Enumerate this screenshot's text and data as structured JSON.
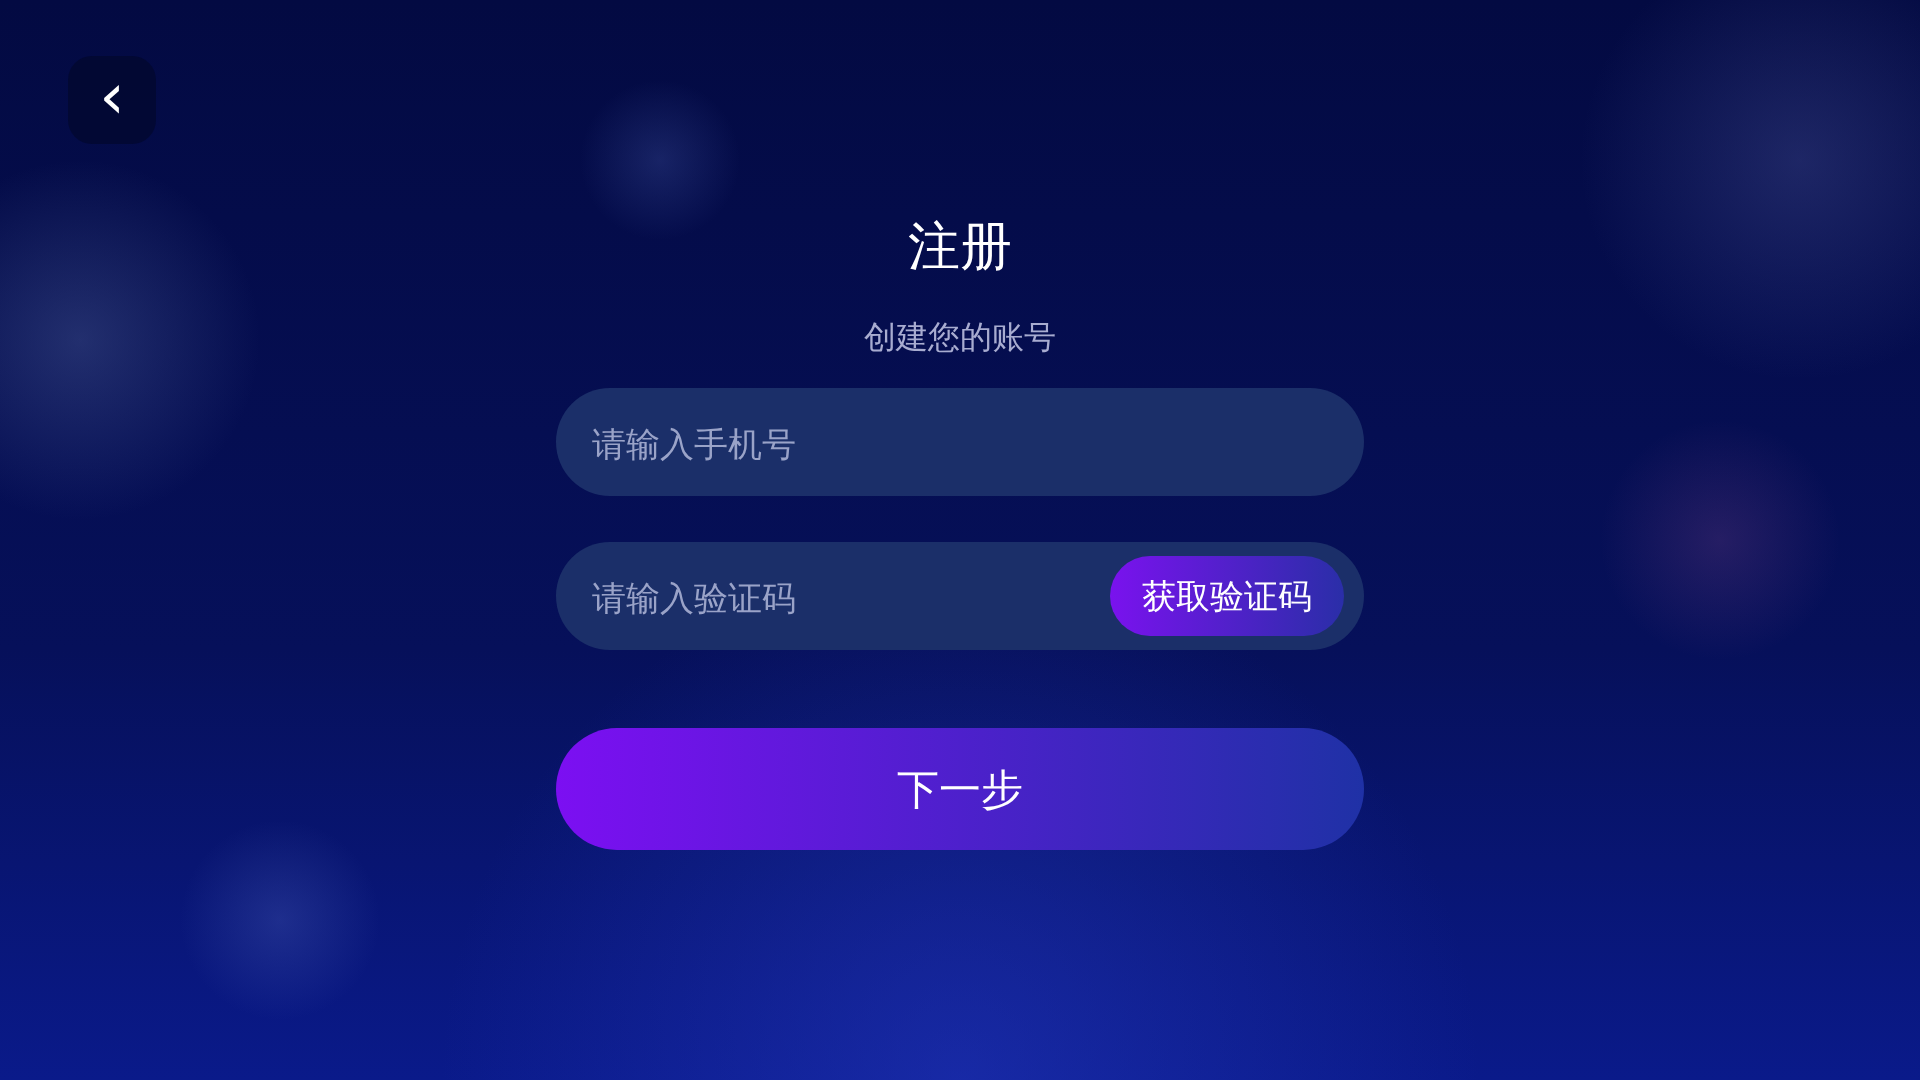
{
  "back_button": {
    "label": "‹"
  },
  "title": "注册",
  "subtitle": "创建您的账号",
  "phone_field": {
    "placeholder": "请输入手机号"
  },
  "code_field": {
    "placeholder": "请输入验证码",
    "button": "获取验证码"
  },
  "next_button": "下一步"
}
